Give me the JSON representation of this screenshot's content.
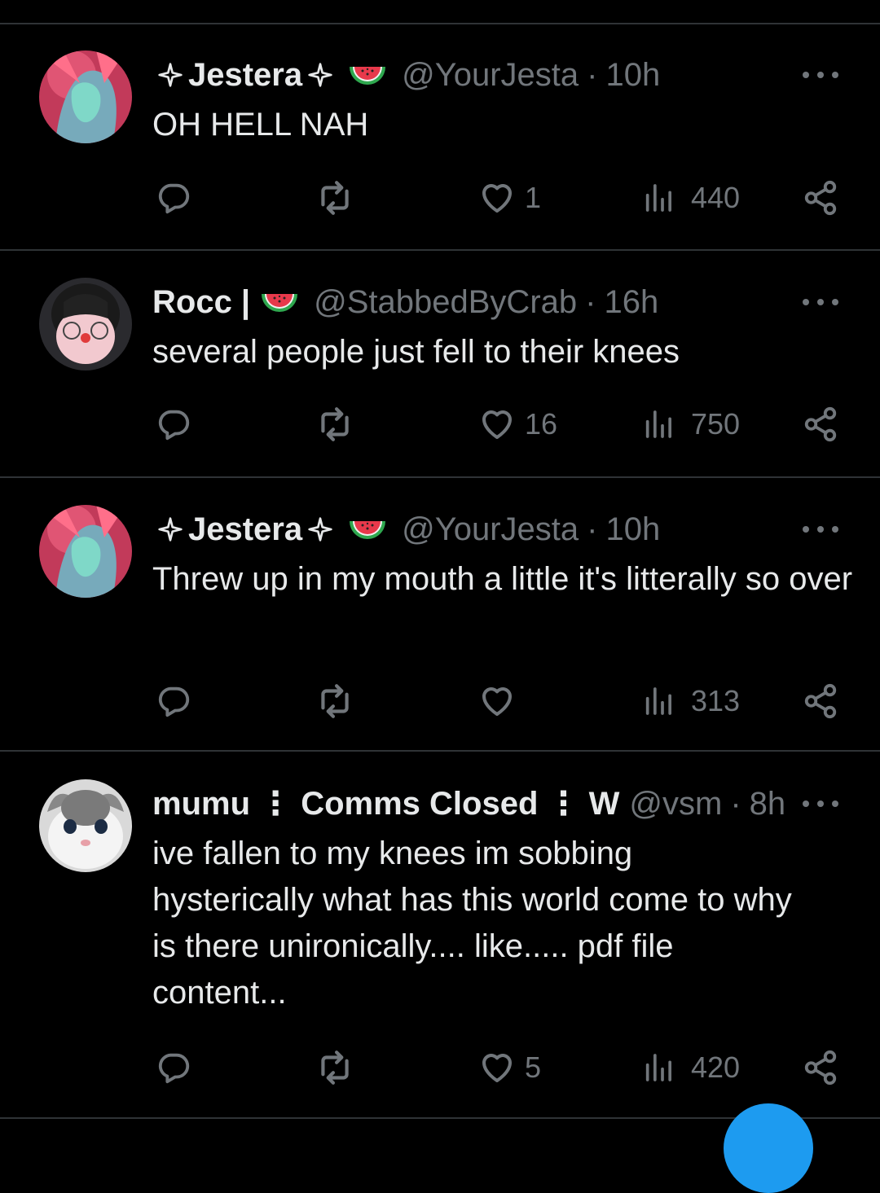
{
  "tweets": [
    {
      "name": "Jestera",
      "handle": "@YourJesta",
      "dot": "·",
      "time": "10h",
      "text": "OH HELL NAH",
      "likes": "1",
      "views": "440"
    },
    {
      "name": "Rocc |",
      "handle": "@StabbedByCrab",
      "dot": "·",
      "time": "16h",
      "text": "several people just fell to their knees",
      "likes": "16",
      "views": "750"
    },
    {
      "name": "Jestera",
      "handle": "@YourJesta",
      "dot": "·",
      "time": "10h",
      "text": "Threw up in my mouth a little it's litterally so over",
      "likes": "",
      "views": "313"
    },
    {
      "name": "mumu ⋮ Comms Closed ⋮ W",
      "handle": "@vsm",
      "dot": "·",
      "time": "8h",
      "text": "ive fallen to my knees im sobbing hysterically what has this world come to why is there unironically.... like..... pdf file content...",
      "likes": "5",
      "views": "420"
    }
  ],
  "icons": {
    "reply": "reply-icon",
    "repost": "repost-icon",
    "like": "heart-icon",
    "views": "views-icon",
    "share": "share-icon",
    "more": "more-icon",
    "badge": "watermelon-icon",
    "sparkle": "sparkle-icon"
  },
  "colors": {
    "background": "#000000",
    "text": "#e7e9ea",
    "secondary": "#71767b",
    "divider": "#2f3336",
    "accent": "#1d9bf0"
  }
}
